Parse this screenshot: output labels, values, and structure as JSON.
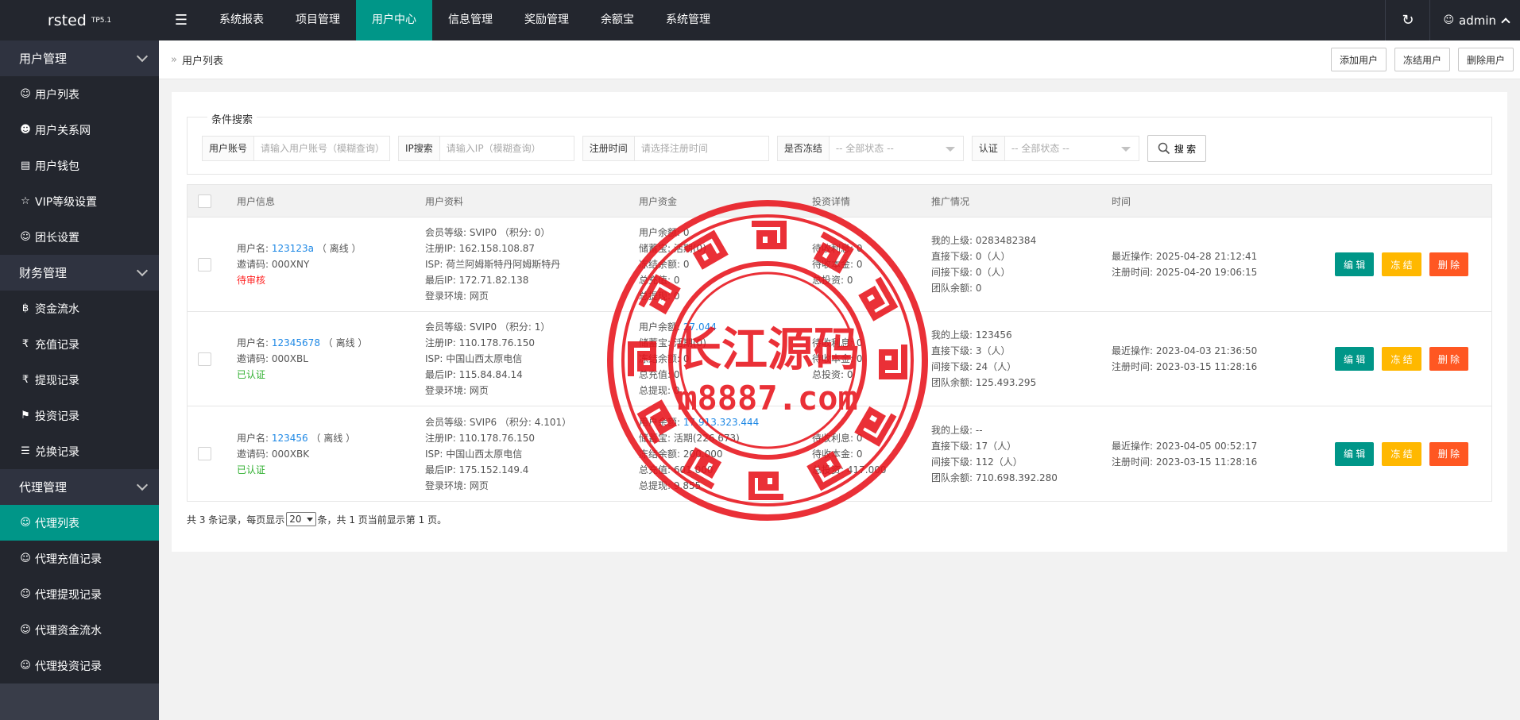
{
  "brand": {
    "name": "rsted",
    "version": "TP5.1"
  },
  "sidebar": {
    "groups": [
      {
        "label": "用户管理",
        "items": [
          {
            "label": "用户列表",
            "icon": "user-icon"
          },
          {
            "label": "用户关系网",
            "icon": "user-network-icon"
          },
          {
            "label": "用户钱包",
            "icon": "wallet-icon"
          },
          {
            "label": "VIP等级设置",
            "icon": "star-icon"
          },
          {
            "label": "团长设置",
            "icon": "user-icon"
          }
        ]
      },
      {
        "label": "财务管理",
        "items": [
          {
            "label": "资金流水",
            "icon": "bitcoin-icon"
          },
          {
            "label": "充值记录",
            "icon": "rupee-icon"
          },
          {
            "label": "提现记录",
            "icon": "rupee-icon"
          },
          {
            "label": "投资记录",
            "icon": "flag-icon"
          },
          {
            "label": "兑换记录",
            "icon": "list-icon"
          }
        ]
      },
      {
        "label": "代理管理",
        "items": [
          {
            "label": "代理列表",
            "icon": "user-icon",
            "active": true
          },
          {
            "label": "代理充值记录",
            "icon": "user-icon"
          },
          {
            "label": "代理提现记录",
            "icon": "user-icon"
          },
          {
            "label": "代理资金流水",
            "icon": "user-icon"
          },
          {
            "label": "代理投资记录",
            "icon": "user-icon"
          }
        ]
      }
    ]
  },
  "topbar": {
    "tabs": [
      "系统报表",
      "项目管理",
      "用户中心",
      "信息管理",
      "奖励管理",
      "余额宝",
      "系统管理"
    ],
    "active_tab": "用户中心",
    "user": "admin"
  },
  "breadcrumb": {
    "current": "用户列表",
    "actions": [
      "添加用户",
      "冻结用户",
      "删除用户"
    ]
  },
  "search": {
    "legend": "条件搜索",
    "fields": [
      {
        "label": "用户账号",
        "placeholder": "请输入用户账号（模糊查询）"
      },
      {
        "label": "IP搜索",
        "placeholder": "请输入IP（模糊查询）"
      },
      {
        "label": "注册时间",
        "placeholder": "请选择注册时间"
      }
    ],
    "selects": [
      {
        "label": "是否冻结",
        "value": "-- 全部状态 --"
      },
      {
        "label": "认证",
        "value": "-- 全部状态 --"
      }
    ],
    "button": "搜 索"
  },
  "table": {
    "headers": [
      "用户信息",
      "用户资料",
      "用户资金",
      "投资详情",
      "推广情况",
      "时间"
    ],
    "rows": [
      {
        "info": {
          "name_label": "用户名:",
          "name": "123123a",
          "online": "（ 离线 ）",
          "invite": "邀请码: 000XNY",
          "status": "待审核",
          "status_color": "#ff2222"
        },
        "profile": [
          "会员等级: SVIP0 （积分: 0）",
          "注册IP: 162.158.108.87",
          "ISP: 荷兰阿姆斯特丹阿姆斯特丹",
          "最后IP: 172.71.82.138",
          "登录环境: 网页"
        ],
        "funds": [
          {
            "label": "用户余额:",
            "value": "0"
          },
          {
            "label": "储蓄宝:",
            "value": "活期(0)"
          },
          {
            "label": "冻结余额:",
            "value": "0"
          },
          {
            "label": "总充值:",
            "value": "0"
          },
          {
            "label": "总提现:",
            "value": "0"
          }
        ],
        "invest": [
          "待收利息: 0",
          "待收本金: 0",
          "总投资: 0"
        ],
        "promo": [
          "我的上级: 0283482384",
          "直接下级: 0（人）",
          "间接下级: 0（人）",
          "团队余额: 0"
        ],
        "time": [
          "最近操作: 2025-04-28 21:12:41",
          "注册时间: 2025-04-20 19:06:15"
        ]
      },
      {
        "info": {
          "name_label": "用户名:",
          "name": "12345678",
          "online": "（ 离线 ）",
          "invite": "邀请码: 000XBL",
          "status": "已认证",
          "status_color": "#2faf2f"
        },
        "profile": [
          "会员等级: SVIP0 （积分: 1）",
          "注册IP: 110.178.76.150",
          "ISP: 中国山西太原电信",
          "最后IP: 115.84.84.14",
          "登录环境: 网页"
        ],
        "funds": [
          {
            "label": "用户余额:",
            "value": "27.044"
          },
          {
            "label": "储蓄宝:",
            "value": "活期(0)"
          },
          {
            "label": "冻结余额:",
            "value": "0"
          },
          {
            "label": "总充值:",
            "value": "0"
          },
          {
            "label": "总提现:",
            "value": "0"
          }
        ],
        "invest": [
          "待收利息: 0",
          "待收本金: 0",
          "总投资: 0"
        ],
        "promo": [
          "我的上级: 123456",
          "直接下级: 3（人）",
          "间接下级: 24（人）",
          "团队余额: 125.493.295"
        ],
        "time": [
          "最近操作: 2023-04-03 21:36:50",
          "注册时间: 2023-03-15 11:28:16"
        ]
      },
      {
        "info": {
          "name_label": "用户名:",
          "name": "123456",
          "online": "（ 离线 ）",
          "invite": "邀请码: 000XBK",
          "status": "已认证",
          "status_color": "#2faf2f"
        },
        "profile": [
          "会员等级: SVIP6 （积分: 4.101）",
          "注册IP: 110.178.76.150",
          "ISP: 中国山西太原电信",
          "最后IP: 175.152.149.4",
          "登录环境: 网页"
        ],
        "funds": [
          {
            "label": "用户余额:",
            "value": "17.913.323.444"
          },
          {
            "label": "储蓄宝:",
            "value": "活期(226.673)"
          },
          {
            "label": "冻结余额:",
            "value": "200.000"
          },
          {
            "label": "总充值:",
            "value": "601.000"
          },
          {
            "label": "总提现:",
            "value": "9.855"
          }
        ],
        "invest": [
          "待收利息: 0",
          "待收本金: 0",
          "总投资: 417.000"
        ],
        "promo": [
          "我的上级: --",
          "直接下级: 17（人）",
          "间接下级: 112（人）",
          "团队余额: 710.698.392.280"
        ],
        "time": [
          "最近操作: 2023-04-05 00:52:17",
          "注册时间: 2023-03-15 11:28:16"
        ]
      }
    ],
    "ops": {
      "edit": "编 辑",
      "freeze": "冻 结",
      "delete": "删 除"
    }
  },
  "pager": {
    "prefix": "共 3 条记录，每页显示",
    "page_size": "20",
    "suffix": "条，共 1 页当前显示第 1 页。"
  },
  "watermark": {
    "line1": "长江源码",
    "line2": "m8887.com",
    "color": "#e8141c"
  }
}
